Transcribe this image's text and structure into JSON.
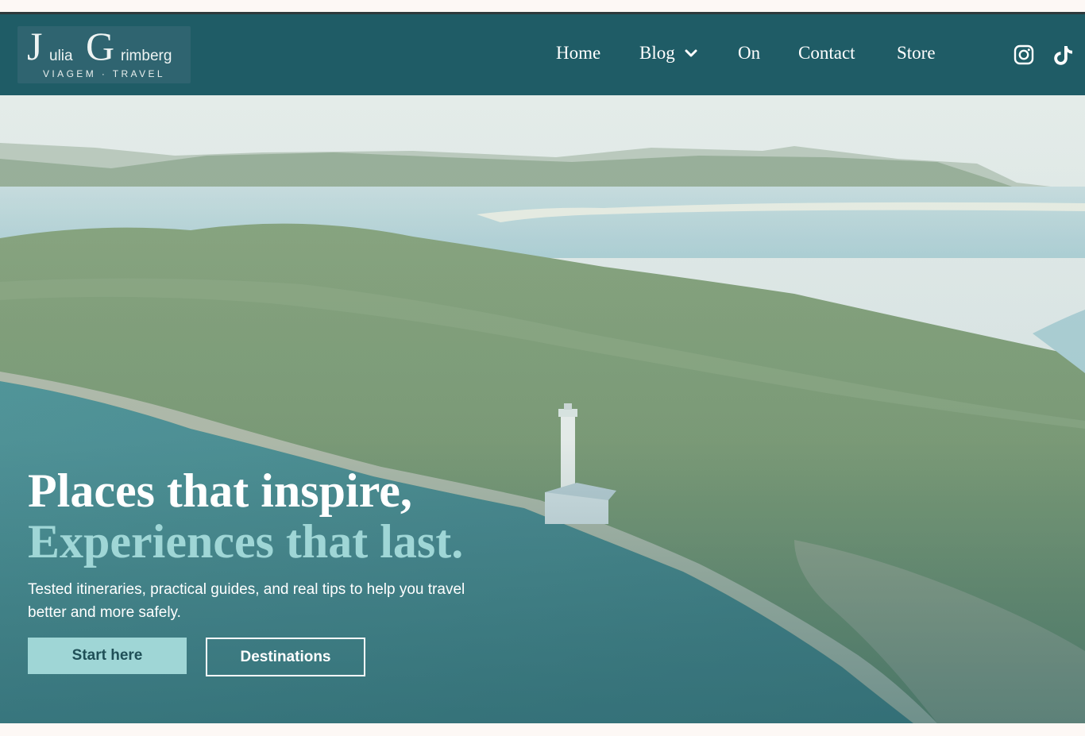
{
  "brand": {
    "logo_initial_j": "J",
    "logo_text_ulia": "ulia",
    "logo_initial_g": "G",
    "logo_text_rimberg": "rimberg",
    "tagline": "VIAGEM · TRAVEL"
  },
  "nav": {
    "items": [
      {
        "label": "Home"
      },
      {
        "label": "Blog"
      },
      {
        "label": "On"
      },
      {
        "label": "Contact"
      },
      {
        "label": "Store"
      }
    ]
  },
  "social": {
    "icons": [
      "instagram-icon",
      "tiktok-icon"
    ]
  },
  "hero": {
    "headline_line1": "Places that inspire,",
    "headline_line2": "Experiences that last.",
    "subtext": "Tested itineraries, practical guides, and real tips to help you travel better and more safely.",
    "primary_button": "Start here",
    "secondary_button": "Destinations"
  },
  "colors": {
    "nav_bg": "#1f5c66",
    "accent_teal": "#9fd6d6",
    "page_bg": "#fdf8f5"
  }
}
